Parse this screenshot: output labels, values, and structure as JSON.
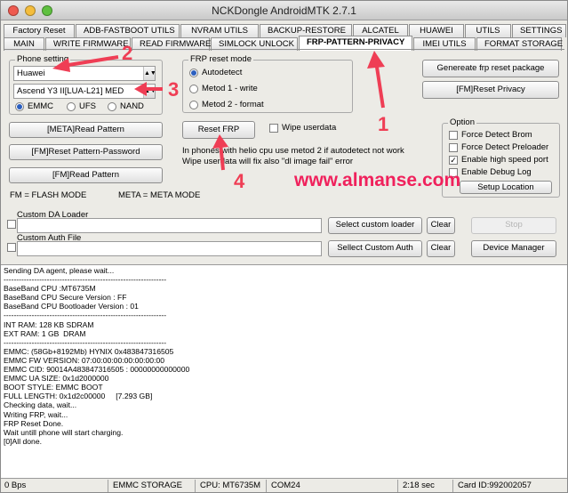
{
  "window": {
    "title": "NCKDongle AndroidMTK 2.7.1"
  },
  "tabs_row1": [
    "Factory Reset",
    "ADB-FASTBOOT UTILS",
    "NVRAM UTILS",
    "BACKUP-RESTORE",
    "ALCATEL",
    "HUAWEI",
    "UTILS",
    "SETTINGS"
  ],
  "tabs_row2": [
    "MAIN",
    "WRITE FIRMWARE",
    "READ FIRMWARE",
    "SIMLOCK UNLOCK",
    "FRP-PATTERN-PRIVACY",
    "IMEI UTILS",
    "FORMAT STORAGE"
  ],
  "phone_setting": {
    "label": "Phone setting",
    "brand": "Huawei",
    "model": "Ascend Y3 II[LUA-L21] MED",
    "storage_options": [
      "EMMC",
      "UFS",
      "NAND"
    ],
    "storage_selected": "EMMC"
  },
  "frp": {
    "label": "FRP reset mode",
    "modes": [
      "Autodetect",
      "Metod 1 - write",
      "Metod 2 - format"
    ],
    "selected": "Autodetect",
    "reset_button": "Reset FRP",
    "wipe_label": "Wipe userdata",
    "wipe_checked": false,
    "note_line1": "In phones with helio cpu use metod 2 if autodetect not work",
    "note_line2": "Wipe userdata will fix also \"dl image fail\" error"
  },
  "buttons": {
    "meta_read_pattern": "[META]Read Pattern",
    "fm_reset_pattern": "[FM]Reset Pattern-Password",
    "fm_read_pattern": "[FM]Read Pattern",
    "gen_frp_package": "Genereate frp reset package",
    "fm_reset_privacy": "[FM]Reset Privacy",
    "select_custom_loader": "Select custom loader",
    "select_custom_auth": "Sellect Custom Auth",
    "clear": "Clear",
    "stop": "Stop",
    "device_manager": "Device Manager",
    "setup_location": "Setup Location"
  },
  "legend": {
    "fm": "FM = FLASH MODE",
    "meta": "META = META MODE"
  },
  "options": {
    "label": "Option",
    "items": [
      {
        "label": "Force Detect Brom",
        "checked": false
      },
      {
        "label": "Force Detect Preloader",
        "checked": false
      },
      {
        "label": "Enable high speed port",
        "checked": true
      },
      {
        "label": "Enable Debug Log",
        "checked": false
      }
    ]
  },
  "custom": {
    "da_label": "Custom DA Loader",
    "auth_label": "Custom Auth File"
  },
  "log": [
    "Sending DA agent, please wait...",
    "----------------------------------------------------------------",
    "BaseBand CPU :MT6735M",
    "BaseBand CPU Secure Version : FF",
    "BaseBand CPU Bootloader Version : 01",
    "----------------------------------------------------------------",
    "INT RAM: 128 KB SDRAM",
    "EXT RAM: 1 GB  DRAM",
    "----------------------------------------------------------------",
    "EMMC: (58Gb+8192Mb) HYNIX 0x483847316505",
    "EMMC FW VERSION: 07:00:00:00:00:00:00:00",
    "EMMC CID: 90014A483847316505 : 00000000000000",
    "EMMC UA SIZE: 0x1d2000000",
    "BOOT STYLE: EMMC BOOT",
    "FULL LENGTH: 0x1d2c00000     [7.293 GB]",
    "Checking data, wait...",
    "",
    "Writing FRP, wait...",
    "FRP Reset Done.",
    "Wait untill phone will start charging.",
    "[0]All done."
  ],
  "status": {
    "speed": "0 Bps",
    "storage": "EMMC STORAGE",
    "cpu": "CPU: MT6735M",
    "port": "COM24",
    "time": "2:18 sec",
    "card": "Card ID:992002057"
  },
  "annotations": {
    "n1": "1",
    "n2": "2",
    "n3": "3",
    "n4": "4",
    "website": "www.almanse.com",
    "color": "#ef3e55"
  }
}
